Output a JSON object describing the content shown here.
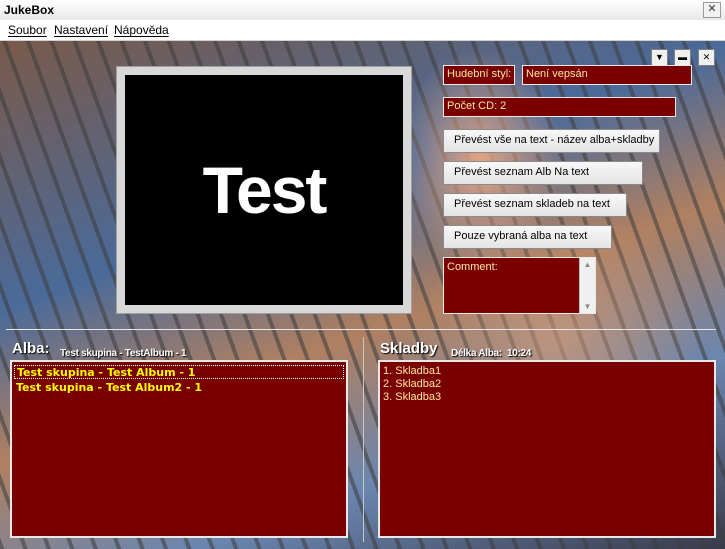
{
  "window": {
    "title": "JukeBox",
    "close_glyph": "✕"
  },
  "menu": [
    {
      "label": "Soubor"
    },
    {
      "label": "Nastavení"
    },
    {
      "label": "Nápověda"
    }
  ],
  "cover": {
    "text": "Test"
  },
  "window_controls": {
    "dropdown_glyph": "▼",
    "minimize_glyph": "▬",
    "close_glyph": "✕"
  },
  "info": {
    "style_label": "Hudební styl:",
    "style_value": "Není vepsán",
    "cd_count": "Počet CD: 2"
  },
  "buttons": {
    "export_all": "Převést vše na text - název alba+skladby",
    "export_albums": "Převést seznam Alb Na text",
    "export_tracks": "Převést seznam skladeb na text",
    "export_selected": "Pouze vybraná alba na text"
  },
  "comment": {
    "value": "Comment:"
  },
  "albums": {
    "heading": "Alba:",
    "current": "Test skupina - TestAlbum - 1",
    "items": [
      {
        "label": "Test skupina - Test Album - 1",
        "selected": true
      },
      {
        "label": "Test skupina - Test Album2 - 1",
        "selected": false
      }
    ]
  },
  "tracks": {
    "heading": "Skladby",
    "length_label": "Délka Alba:",
    "length_value": "10:24",
    "items": [
      {
        "label": "1. Skladba1"
      },
      {
        "label": "2. Skladba2"
      },
      {
        "label": "3. Skladba3"
      }
    ]
  },
  "colors": {
    "list_bg": "#7a0000",
    "album_text": "#ffff00",
    "track_text": "#ffe9a0"
  }
}
